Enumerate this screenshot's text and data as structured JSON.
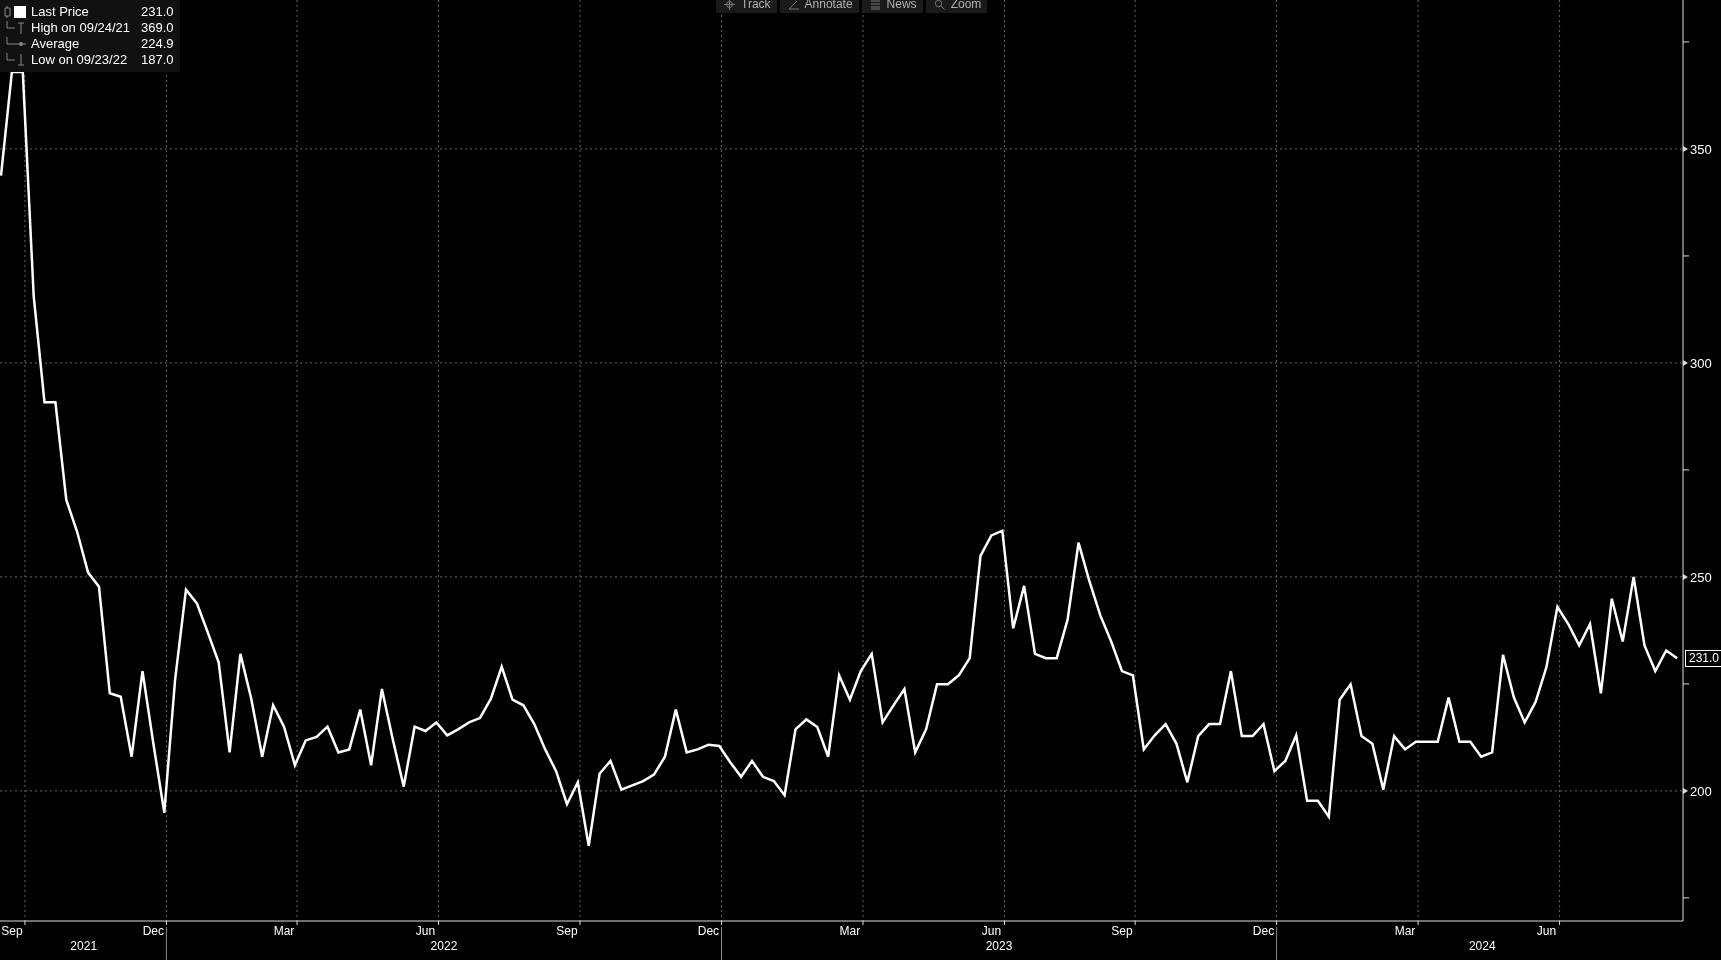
{
  "toolbar": [
    {
      "kind": "track",
      "label": "Track"
    },
    {
      "kind": "annotate",
      "label": "Annotate"
    },
    {
      "kind": "news",
      "label": "News"
    },
    {
      "kind": "zoom",
      "label": "Zoom"
    }
  ],
  "legend": [
    {
      "kind": "series",
      "value": "231.0"
    },
    {
      "kind": "high",
      "label": "High on 09/24/21",
      "value": "369.0"
    },
    {
      "kind": "average",
      "label": "Average",
      "value": "224.9"
    },
    {
      "kind": "low",
      "label": "Low on 09/23/22",
      "value": "187.0"
    }
  ],
  "last_price_tag": "231.0",
  "year_axis": [
    {
      "label": "2021"
    },
    {
      "label": "2022"
    },
    {
      "label": "2023"
    },
    {
      "label": "2024"
    }
  ],
  "chart_data": {
    "type": "line",
    "grid": true,
    "ylim": [
      169.6,
      384.8
    ],
    "yticks": [
      200,
      250,
      300,
      350
    ],
    "categories": [
      null,
      "Sep",
      null,
      null,
      null,
      null,
      null,
      null,
      null,
      null,
      null,
      null,
      null,
      null,
      "Dec",
      null,
      null,
      null,
      null,
      null,
      null,
      null,
      null,
      null,
      null,
      null,
      "Mar",
      null,
      null,
      null,
      null,
      null,
      null,
      null,
      null,
      null,
      null,
      null,
      null,
      "Jun",
      null,
      null,
      null,
      null,
      null,
      null,
      null,
      null,
      null,
      null,
      null,
      null,
      "Sep",
      null,
      null,
      null,
      null,
      null,
      null,
      null,
      null,
      null,
      null,
      null,
      null,
      "Dec",
      null,
      null,
      null,
      null,
      null,
      null,
      null,
      null,
      null,
      null,
      null,
      null,
      "Mar",
      null,
      null,
      null,
      null,
      null,
      null,
      null,
      null,
      null,
      null,
      null,
      null,
      "Jun",
      null,
      null,
      null,
      null,
      null,
      null,
      null,
      null,
      null,
      null,
      null,
      "Sep",
      null,
      null,
      null,
      null,
      null,
      null,
      null,
      null,
      null,
      null,
      null,
      null,
      "Dec",
      null,
      null,
      null,
      null,
      null,
      null,
      null,
      null,
      null,
      null,
      null,
      null,
      "Mar",
      null,
      null,
      null,
      null,
      null,
      null,
      null,
      null,
      null,
      null,
      null,
      null,
      "Jun",
      null,
      null,
      null,
      null,
      null,
      null,
      null,
      null,
      null,
      null,
      null,
      null
    ],
    "series": [
      {
        "name": "Last Price",
        "color": "#ffffff",
        "values": [
          343.8,
          368,
          368,
          315.6,
          290.8,
          290.8,
          268,
          260.5,
          251,
          247.7,
          222.8,
          222,
          208,
          228,
          211,
          194.9,
          226,
          247,
          243.8,
          237,
          230,
          209,
          232,
          221.5,
          208,
          220,
          215,
          206,
          211.8,
          212.6,
          215,
          209,
          209.7,
          219,
          206,
          223.8,
          212,
          201,
          215,
          214,
          216,
          213,
          214.4,
          216,
          217,
          221.5,
          229,
          221.3,
          220,
          215.6,
          209.7,
          204.6,
          196.9,
          202,
          187.2,
          204,
          207,
          200.3,
          201.3,
          202.3,
          203.8,
          208,
          219,
          209,
          209.7,
          210.8,
          210.5,
          206.7,
          203.3,
          207,
          203.3,
          202.3,
          199,
          214.4,
          216.7,
          214.9,
          208,
          227,
          221.3,
          228,
          232,
          216,
          220,
          223.8,
          209,
          214.4,
          224.9,
          224.9,
          227,
          231,
          254.9,
          259.7,
          260.8,
          238,
          247.9,
          232,
          231,
          231,
          240,
          258,
          249,
          241,
          234.9,
          228,
          227,
          209.7,
          213,
          215.6,
          211,
          202,
          212.8,
          215.6,
          215.6,
          228,
          212.8,
          212.8,
          215.6,
          204.6,
          207,
          213,
          197.7,
          197.7,
          194,
          221.3,
          224.9,
          212.8,
          211,
          200.3,
          212.8,
          209.7,
          211.5,
          211.5,
          211.5,
          221.8,
          211.5,
          211.5,
          208,
          209,
          231.8,
          221.8,
          216,
          220.8,
          229,
          243,
          239,
          234,
          239,
          222.8,
          244.9,
          234.9,
          250,
          234,
          228,
          232.8,
          231
        ]
      }
    ]
  }
}
